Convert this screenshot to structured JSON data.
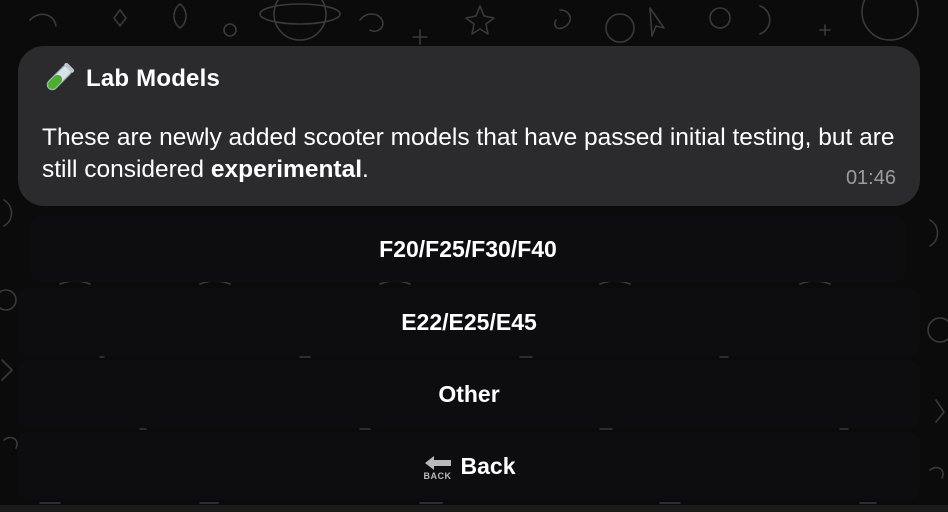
{
  "message": {
    "icon": "test-tube-icon",
    "title": "Lab Models",
    "body_text": "These are newly added scooter models that have passed initial testing, but are still considered ",
    "body_bold": "experimental",
    "body_end": ".",
    "time": "01:46"
  },
  "keyboard": {
    "buttons": [
      {
        "label": "F20/F25/F30/F40"
      },
      {
        "label": "E22/E25/E45"
      },
      {
        "label": "Other"
      },
      {
        "label": "Back",
        "icon": "back-arrow-icon",
        "icon_text": "BACK"
      }
    ]
  },
  "colors": {
    "bubble": "#2b2b2d",
    "button": "#0e0e10",
    "time": "#9a9aa0",
    "background": "#0b0b0c"
  }
}
